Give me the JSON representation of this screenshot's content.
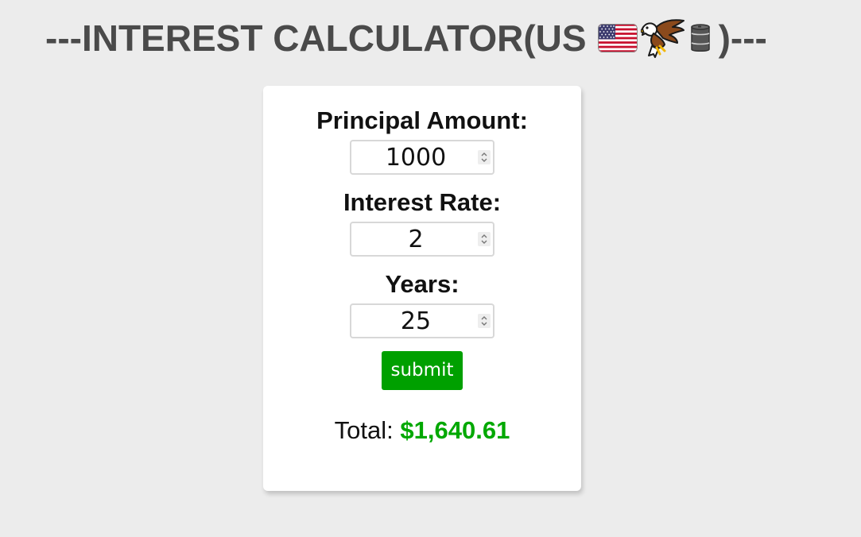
{
  "title": {
    "prefix": "---INTEREST CALCULATOR(US",
    "suffix": ")---",
    "icons": [
      "us-flag-icon",
      "eagle-icon",
      "oil-barrel-icon"
    ]
  },
  "form": {
    "principal": {
      "label": "Principal Amount:",
      "value": "1000"
    },
    "rate": {
      "label": "Interest Rate:",
      "value": "2"
    },
    "years": {
      "label": "Years:",
      "value": "25"
    },
    "submit_label": "submit"
  },
  "result": {
    "label": "Total:",
    "value": "$1,640.61"
  },
  "colors": {
    "background": "#ececec",
    "title": "#4a4a4a",
    "accent_green": "#00a000",
    "total_green": "#00a800"
  }
}
